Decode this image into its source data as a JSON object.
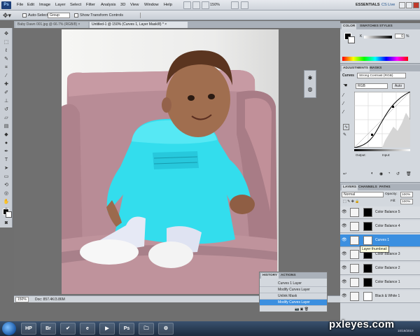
{
  "app": {
    "logo": "Ps",
    "menus": [
      "File",
      "Edit",
      "Image",
      "Layer",
      "Select",
      "Filter",
      "Analysis",
      "3D",
      "View",
      "Window",
      "Help"
    ],
    "zoom": "150%",
    "workspace": "ESSENTIALS",
    "cs_live": "CS Live"
  },
  "options": {
    "auto_select_label": "Auto-Select:",
    "auto_select_value": "Group",
    "show_transform": "Show Transform Controls"
  },
  "tabs": [
    {
      "label": "Baby Dawn 001.jpg @ 66.7% (RGB/8) ×"
    },
    {
      "label": "Untitled-1 @ 150% (Curves 1, Layer Mask/8) * ×"
    }
  ],
  "status": {
    "zoom": "150%",
    "doc": "Doc: 857.4K/3.86M"
  },
  "color_panel": {
    "tabs": [
      "COLOR",
      "SWATCHES",
      "STYLES"
    ],
    "slider_label": "K",
    "slider_value": "0",
    "unit": "%"
  },
  "adjustments_panel": {
    "tabs": [
      "ADJUSTMENTS",
      "MASKS"
    ],
    "label": "Curves",
    "preset": "Strong Contrast (RGB)",
    "channel": "RGB",
    "auto": "Auto",
    "output": "Output:",
    "input": "Input:"
  },
  "layers_panel": {
    "tabs": [
      "LAYERS",
      "CHANNELS",
      "PATHS"
    ],
    "blend_mode": "Normal",
    "opacity_label": "Opacity:",
    "opacity": "100%",
    "fill_label": "Fill:",
    "fill": "100%",
    "tooltip": "Layer thumbnail",
    "layers": [
      {
        "name": "Color Balance 5",
        "selected": false
      },
      {
        "name": "Color Balance 4",
        "selected": false
      },
      {
        "name": "Curves 1",
        "selected": true
      },
      {
        "name": "Color Balance 3",
        "selected": false
      },
      {
        "name": "Color Balance 2",
        "selected": false
      },
      {
        "name": "Color Balance 1",
        "selected": false
      },
      {
        "name": "Black & White 1",
        "selected": false
      }
    ]
  },
  "history_panel": {
    "tabs": [
      "HISTORY",
      "ACTIONS"
    ],
    "items": [
      {
        "label": "Curves 1 Layer",
        "selected": false
      },
      {
        "label": "Modify Curves Layer",
        "selected": false
      },
      {
        "label": "Unlink Mask",
        "selected": false
      },
      {
        "label": "Modify Curves Layer",
        "selected": true
      }
    ]
  },
  "taskbar": {
    "apps": [
      "HP",
      "Br",
      "✔",
      "e",
      "▶",
      "Ps",
      "🗀",
      "⚙"
    ],
    "date": "10/19/2010"
  },
  "watermark": "pxleyes.com",
  "colors": {
    "selected": "#3b8fe0",
    "dress": "#2ee0f0",
    "sofa": "#b48a92"
  }
}
